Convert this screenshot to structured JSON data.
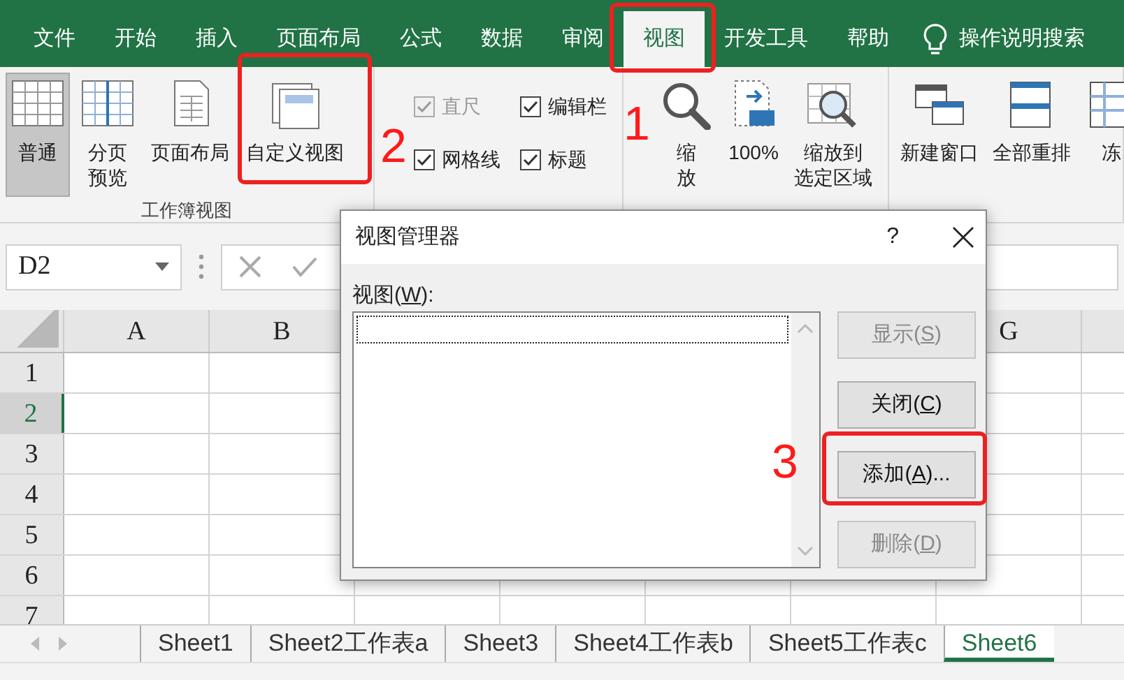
{
  "ribbon_tabs": [
    {
      "label": "文件",
      "selected": false
    },
    {
      "label": "开始",
      "selected": false
    },
    {
      "label": "插入",
      "selected": false
    },
    {
      "label": "页面布局",
      "selected": false
    },
    {
      "label": "公式",
      "selected": false
    },
    {
      "label": "数据",
      "selected": false
    },
    {
      "label": "审阅",
      "selected": false
    },
    {
      "label": "视图",
      "selected": true
    },
    {
      "label": "开发工具",
      "selected": false
    },
    {
      "label": "帮助",
      "selected": false
    }
  ],
  "search": {
    "label": "操作说明搜索"
  },
  "ribbon_groups": [
    {
      "kind": "buttons",
      "label": "工作簿视图",
      "items": [
        {
          "lines": [
            "普通"
          ],
          "selected": true
        },
        {
          "lines": [
            "分页",
            "预览"
          ],
          "selected": false
        },
        {
          "lines": [
            "页面布局"
          ],
          "selected": false
        },
        {
          "lines": [
            "自定义视图"
          ],
          "selected": false
        }
      ]
    },
    {
      "kind": "checks",
      "items": [
        {
          "label": "直尺",
          "checked": true,
          "disabled": true
        },
        {
          "label": "编辑栏",
          "checked": true,
          "disabled": false
        },
        {
          "label": "网格线",
          "checked": true,
          "disabled": false
        },
        {
          "label": "标题",
          "checked": true,
          "disabled": false
        }
      ]
    },
    {
      "kind": "buttons",
      "items": [
        {
          "lines": [
            "缩",
            "放"
          ]
        },
        {
          "lines": [
            "100%"
          ]
        },
        {
          "lines": [
            "缩放到",
            "选定区域"
          ]
        }
      ]
    },
    {
      "kind": "buttons",
      "items": [
        {
          "lines": [
            "新建窗口"
          ]
        },
        {
          "lines": [
            "全部重排"
          ]
        },
        {
          "lines": [
            "冻"
          ]
        }
      ]
    }
  ],
  "name_box": {
    "value": "D2"
  },
  "sheet": {
    "columns": [
      {
        "label": "A"
      },
      {
        "label": "B"
      },
      {
        "label": "G"
      }
    ],
    "rows": [
      {
        "label": "1",
        "selected": false
      },
      {
        "label": "2",
        "selected": true
      },
      {
        "label": "3",
        "selected": false
      },
      {
        "label": "4",
        "selected": false
      },
      {
        "label": "5",
        "selected": false
      },
      {
        "label": "6",
        "selected": false
      },
      {
        "label": "7",
        "selected": false
      }
    ]
  },
  "sheet_tabs": [
    {
      "label": "Sheet1",
      "selected": false
    },
    {
      "label": "Sheet2工作表a",
      "selected": false
    },
    {
      "label": "Sheet3",
      "selected": false
    },
    {
      "label": "Sheet4工作表b",
      "selected": false
    },
    {
      "label": "Sheet5工作表c",
      "selected": false
    },
    {
      "label": "Sheet6",
      "selected": true
    }
  ],
  "dialog": {
    "title": "视图管理器",
    "help": "?",
    "list_label": {
      "before": "视图(",
      "key": "W",
      "after": "):"
    },
    "buttons": [
      {
        "before": "显示(",
        "key": "S",
        "after": ")",
        "disabled": true
      },
      {
        "before": "关闭(",
        "key": "C",
        "after": ")",
        "disabled": false
      },
      {
        "before": "添加(",
        "key": "A",
        "after": ")...",
        "disabled": false
      },
      {
        "before": "删除(",
        "key": "D",
        "after": ")",
        "disabled": true
      }
    ]
  },
  "annotations": [
    {
      "label": "1"
    },
    {
      "label": "2"
    },
    {
      "label": "3"
    }
  ]
}
